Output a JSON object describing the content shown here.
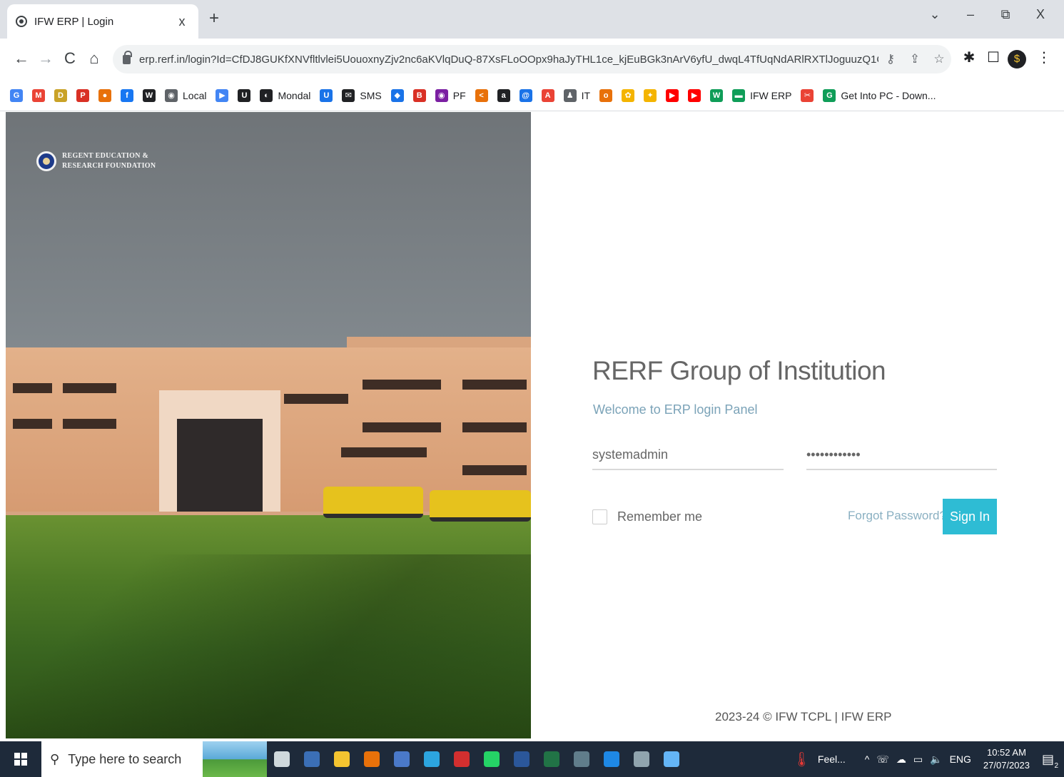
{
  "browser": {
    "tab_title": "IFW ERP | Login",
    "tab_close": "x",
    "new_tab": "+",
    "url": "erp.rerf.in/login?Id=CfDJ8GUKfXNVfltlvlei5UouoxnyZjv2nc6aKVlqDuQ-87XsFLoOOpx9haJyTHL1ce_kjEuBGk3nArV6yfU_dwqL4TfUqNdARlRXTlJoguuzQ1O...",
    "window_controls": {
      "collapse": "⌄",
      "minimize": "–",
      "restore": "⧉",
      "close": "X"
    },
    "nav": {
      "back": "←",
      "forward": "→",
      "reload": "C",
      "home": "⌂"
    },
    "omnibox_icons": {
      "key": "⚷",
      "share": "⇪",
      "star": "☆"
    },
    "extensions": {
      "puzzle": "✱",
      "sidepanel": "☐",
      "profile": "$",
      "menu": "⋮"
    }
  },
  "bookmarks": [
    {
      "icon": "G",
      "label": "",
      "color": "#4285f4"
    },
    {
      "icon": "M",
      "label": "",
      "color": "#ea4335"
    },
    {
      "icon": "D",
      "label": "",
      "color": "#c9a227"
    },
    {
      "icon": "P",
      "label": "",
      "color": "#d93025"
    },
    {
      "icon": "●",
      "label": "",
      "color": "#e8710a"
    },
    {
      "icon": "f",
      "label": "",
      "color": "#1877f2"
    },
    {
      "icon": "W",
      "label": "",
      "color": "#202124"
    },
    {
      "icon": "◉",
      "label": "Local",
      "color": "#5f6368"
    },
    {
      "icon": "▶",
      "label": "",
      "color": "#4285f4"
    },
    {
      "icon": "U",
      "label": "",
      "color": "#202124"
    },
    {
      "icon": "◐",
      "label": "Mondal",
      "color": "#202124"
    },
    {
      "icon": "U",
      "label": "",
      "color": "#1a73e8"
    },
    {
      "icon": "✉",
      "label": "SMS",
      "color": "#202124"
    },
    {
      "icon": "◆",
      "label": "",
      "color": "#1a73e8"
    },
    {
      "icon": "B",
      "label": "",
      "color": "#d93025"
    },
    {
      "icon": "◉",
      "label": "PF",
      "color": "#7b1fa2"
    },
    {
      "icon": "<",
      "label": "",
      "color": "#e8710a"
    },
    {
      "icon": "a",
      "label": "",
      "color": "#202124"
    },
    {
      "icon": "@",
      "label": "",
      "color": "#1a73e8"
    },
    {
      "icon": "A",
      "label": "",
      "color": "#ea4335"
    },
    {
      "icon": "♟",
      "label": "IT",
      "color": "#5f6368"
    },
    {
      "icon": "o",
      "label": "",
      "color": "#e8710a"
    },
    {
      "icon": "✿",
      "label": "",
      "color": "#f4b400"
    },
    {
      "icon": "✦",
      "label": "",
      "color": "#f4b400"
    },
    {
      "icon": "▶",
      "label": "",
      "color": "#ff0000"
    },
    {
      "icon": "▶",
      "label": "",
      "color": "#ff0000"
    },
    {
      "icon": "W",
      "label": "",
      "color": "#0f9d58"
    },
    {
      "icon": "▬",
      "label": "IFW ERP",
      "color": "#0f9d58"
    },
    {
      "icon": "✂",
      "label": "",
      "color": "#ea4335"
    },
    {
      "icon": "G",
      "label": "Get Into PC - Down...",
      "color": "#0f9d58"
    }
  ],
  "logo": {
    "line1": "REGENT EDUCATION &",
    "line2": "RESEARCH FOUNDATION"
  },
  "login": {
    "title": "RERF Group of Institution",
    "subtitle": "Welcome to ERP login Panel",
    "username_value": "systemadmin",
    "password_value": "••••••••••••",
    "remember_label": "Remember me",
    "forgot_label": "Forgot Password?",
    "signin_label": "Sign In"
  },
  "footer": {
    "text": "2023-24 © IFW TCPL  |  IFW ERP"
  },
  "taskbar": {
    "search_placeholder": "Type here to search",
    "search_icon": "⚲",
    "apps": [
      {
        "name": "task-view",
        "color": "#cfd8dc"
      },
      {
        "name": "calculator",
        "color": "#3b6fb6"
      },
      {
        "name": "file-explorer",
        "color": "#f4c430"
      },
      {
        "name": "chrome",
        "color": "#e8710a"
      },
      {
        "name": "app-blue",
        "color": "#4a79c9"
      },
      {
        "name": "telegram",
        "color": "#2ca5e0"
      },
      {
        "name": "app-red",
        "color": "#d32f2f"
      },
      {
        "name": "whatsapp",
        "color": "#25d366"
      },
      {
        "name": "word",
        "color": "#2b579a"
      },
      {
        "name": "excel",
        "color": "#217346"
      },
      {
        "name": "app-record",
        "color": "#607d8b"
      },
      {
        "name": "app-circle",
        "color": "#1e88e5"
      },
      {
        "name": "app-figure",
        "color": "#90a4ae"
      },
      {
        "name": "app-photo",
        "color": "#64b5f6"
      }
    ],
    "weather_label": "Feel...",
    "tray_chevron": "^",
    "tray_lang": "ENG",
    "time": "10:52 AM",
    "date": "27/07/2023",
    "notification_count": "2"
  }
}
